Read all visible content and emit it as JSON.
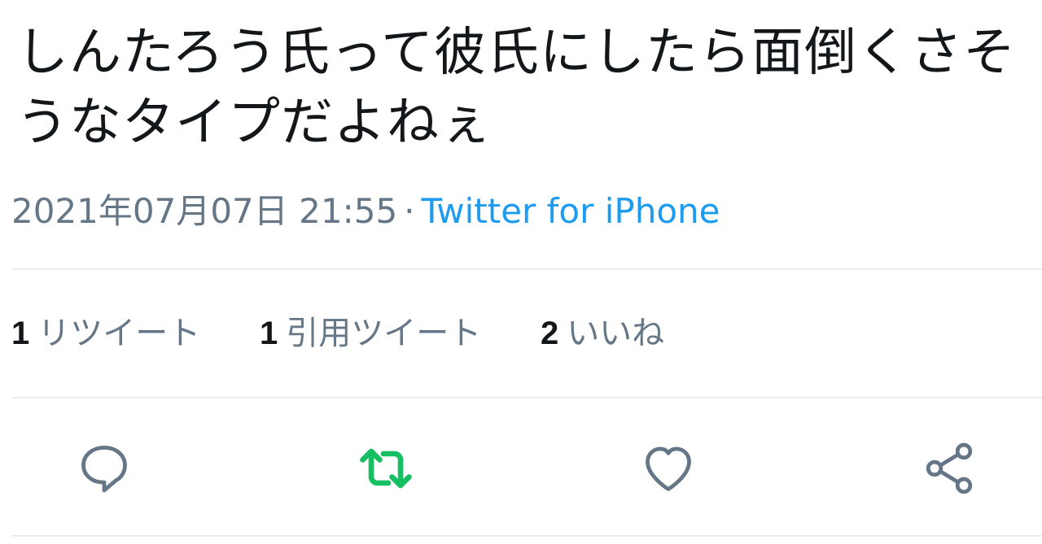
{
  "tweet": {
    "text": "しんたろう氏って彼氏にしたら面倒くさそうなタイプだよねぇ",
    "timestamp": "2021年07月07日 21:55",
    "separator": "·",
    "source": "Twitter for iPhone"
  },
  "stats": {
    "retweets": {
      "count": "1",
      "label": "リツイート"
    },
    "quotes": {
      "count": "1",
      "label": "引用ツイート"
    },
    "likes": {
      "count": "2",
      "label": "いいね"
    }
  },
  "actions": [
    {
      "name": "reply",
      "icon": "reply-icon",
      "color": "#657786"
    },
    {
      "name": "retweet",
      "icon": "retweet-icon",
      "color": "#17bf63",
      "active": true
    },
    {
      "name": "like",
      "icon": "heart-icon",
      "color": "#657786"
    },
    {
      "name": "share",
      "icon": "share-icon",
      "color": "#657786"
    }
  ]
}
